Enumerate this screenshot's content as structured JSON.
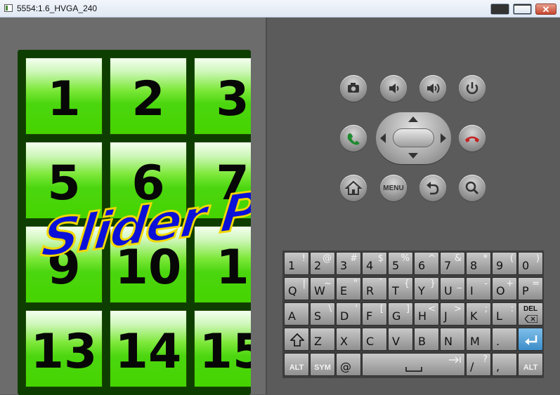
{
  "window": {
    "title": "5554:1.6_HVGA_240"
  },
  "game": {
    "tiles": [
      "1",
      "2",
      "3",
      "5",
      "6",
      "7",
      "9",
      "10",
      "1",
      "13",
      "14",
      "15"
    ],
    "overlay_title": "Slider Puzzl"
  },
  "controls": {
    "menu_label": "MENU"
  },
  "keyboard": {
    "row1": [
      {
        "main": "1",
        "alt": "!"
      },
      {
        "main": "2",
        "alt": "@"
      },
      {
        "main": "3",
        "alt": "#"
      },
      {
        "main": "4",
        "alt": "$"
      },
      {
        "main": "5",
        "alt": "%"
      },
      {
        "main": "6",
        "alt": "^"
      },
      {
        "main": "7",
        "alt": "&"
      },
      {
        "main": "8",
        "alt": "*"
      },
      {
        "main": "9",
        "alt": "("
      },
      {
        "main": "0",
        "alt": ")"
      }
    ],
    "row2": [
      {
        "main": "Q",
        "alt": "|"
      },
      {
        "main": "W",
        "alt": "~"
      },
      {
        "main": "E",
        "alt": "\""
      },
      {
        "main": "R",
        "alt": "`"
      },
      {
        "main": "T",
        "alt": "{"
      },
      {
        "main": "Y",
        "alt": "}"
      },
      {
        "main": "U",
        "alt": "_"
      },
      {
        "main": "I",
        "alt": "-"
      },
      {
        "main": "O",
        "alt": "+"
      },
      {
        "main": "P",
        "alt": "="
      }
    ],
    "row3": [
      {
        "main": "A",
        "alt": ""
      },
      {
        "main": "S",
        "alt": "\\"
      },
      {
        "main": "D",
        "alt": "'"
      },
      {
        "main": "F",
        "alt": "["
      },
      {
        "main": "G",
        "alt": "]"
      },
      {
        "main": "H",
        "alt": "<"
      },
      {
        "main": "J",
        "alt": ">"
      },
      {
        "main": "K",
        "alt": ";"
      },
      {
        "main": "L",
        "alt": ":"
      }
    ],
    "del_label": "DEL",
    "row4": [
      {
        "main": "Z",
        "alt": ""
      },
      {
        "main": "X",
        "alt": ""
      },
      {
        "main": "C",
        "alt": ""
      },
      {
        "main": "V",
        "alt": ""
      },
      {
        "main": "B",
        "alt": ""
      },
      {
        "main": "N",
        "alt": ""
      },
      {
        "main": "M",
        "alt": ""
      },
      {
        "main": ".",
        "alt": ""
      }
    ],
    "alt_label": "ALT",
    "sym_label": "SYM",
    "at_label": "@",
    "slash_label": "/",
    "slash_alt": "?",
    "comma_label": ","
  }
}
